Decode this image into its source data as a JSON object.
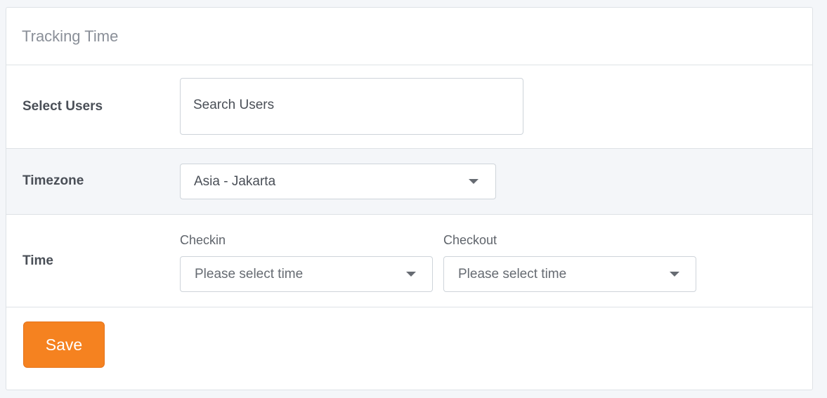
{
  "card": {
    "title": "Tracking Time"
  },
  "users": {
    "label": "Select Users",
    "search_placeholder": "Search Users"
  },
  "timezone": {
    "label": "Timezone",
    "selected": "Asia - Jakarta"
  },
  "time": {
    "label": "Time",
    "checkin_label": "Checkin",
    "checkin_placeholder": "Please select time",
    "checkout_label": "Checkout",
    "checkout_placeholder": "Please select time"
  },
  "actions": {
    "save_label": "Save"
  },
  "icons": {
    "dropdown": "chevron-down-icon"
  },
  "colors": {
    "accent": "#f58220",
    "row_highlight": "#f4f6f9"
  }
}
